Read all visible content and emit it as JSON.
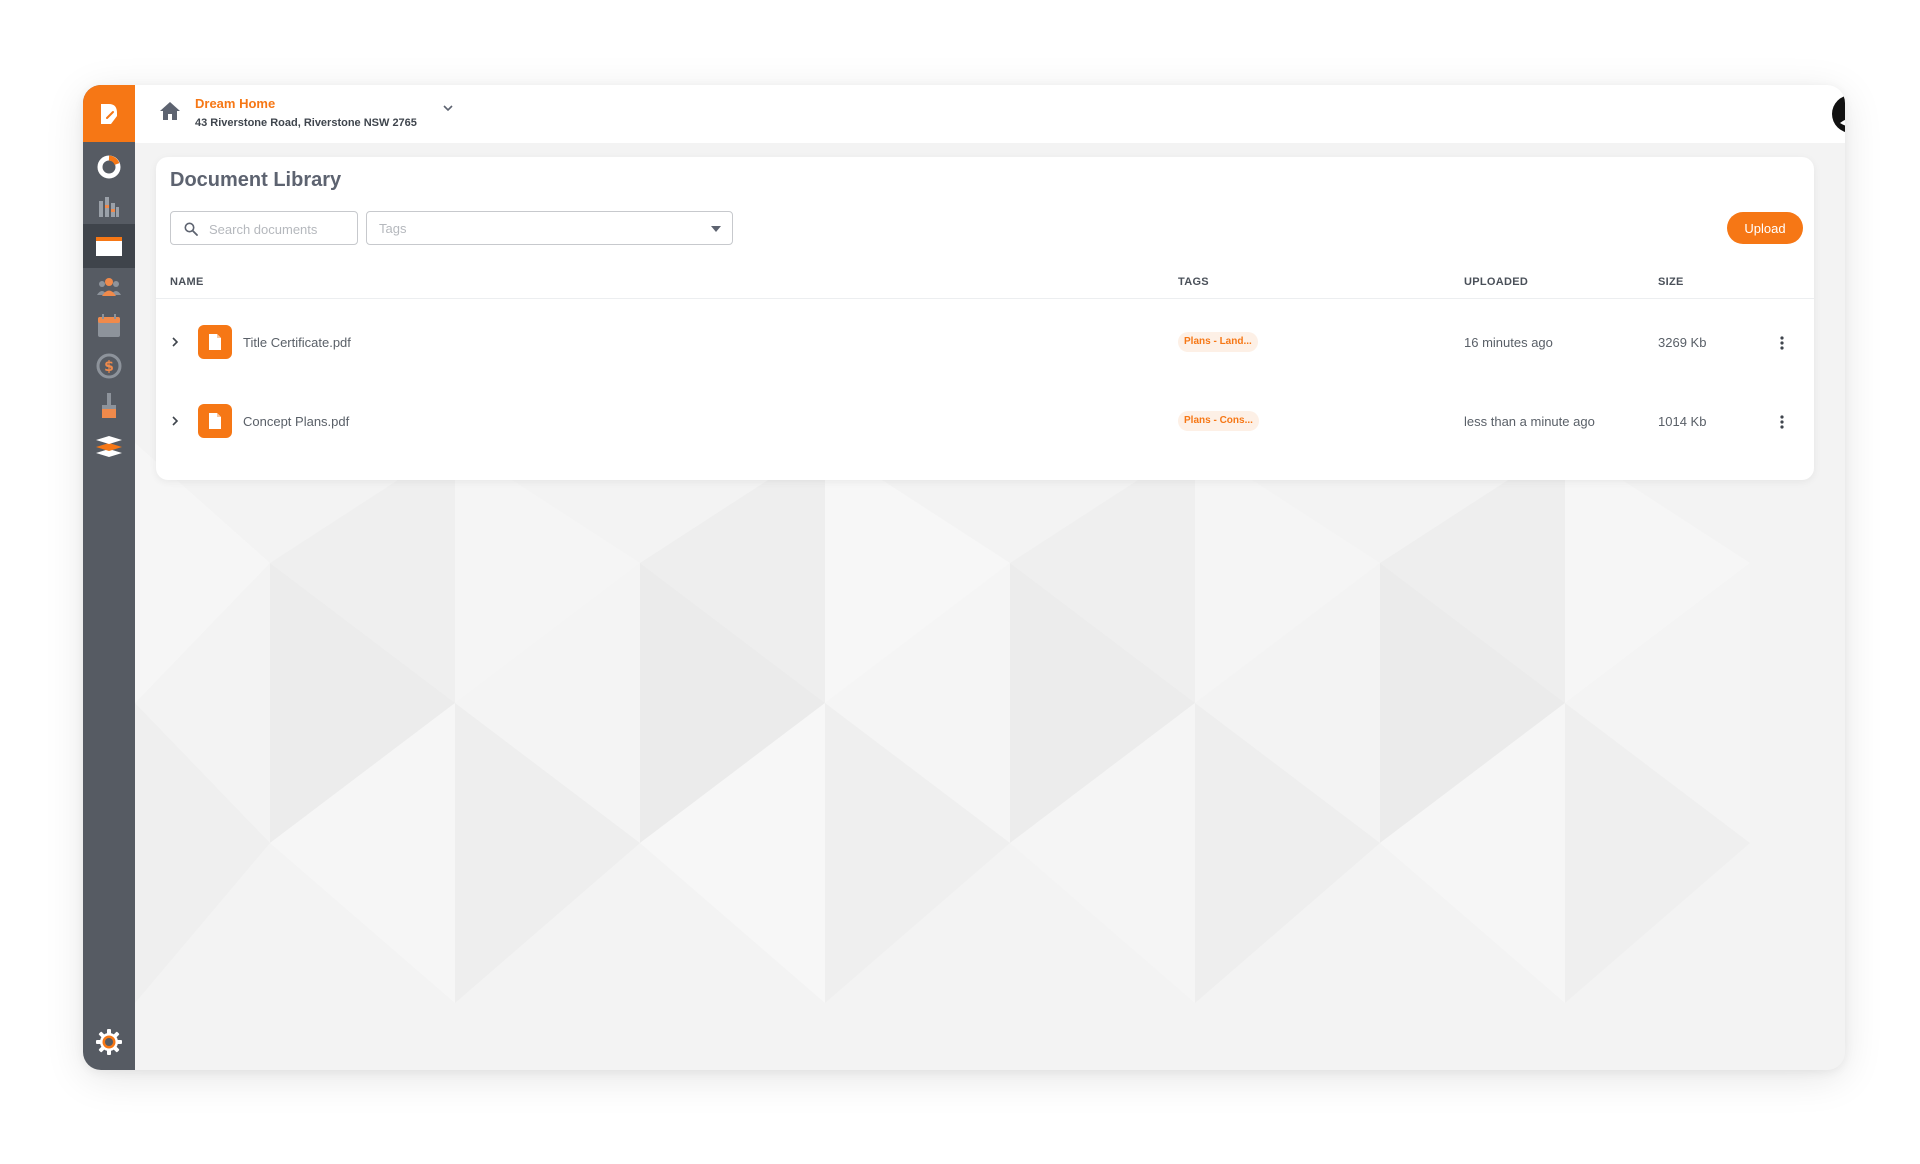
{
  "project": {
    "name": "Dream Home",
    "address": "43 Riverstone Road, Riverstone NSW 2765"
  },
  "sidebar": {
    "items": [
      {
        "icon": "progress-icon"
      },
      {
        "icon": "bar-chart-icon"
      },
      {
        "icon": "folder-icon",
        "active": true
      },
      {
        "icon": "team-icon"
      },
      {
        "icon": "calendar-icon"
      },
      {
        "icon": "dollar-icon"
      },
      {
        "icon": "paint-brush-icon"
      },
      {
        "icon": "layers-icon"
      }
    ],
    "settings_icon": "settings-gear-icon"
  },
  "page": {
    "title": "Document Library",
    "search_placeholder": "Search documents",
    "tags_placeholder": "Tags",
    "upload_label": "Upload"
  },
  "table": {
    "columns": [
      "NAME",
      "TAGS",
      "UPLOADED",
      "SIZE"
    ],
    "rows": [
      {
        "name": "Title Certificate.pdf",
        "tag": "Plans - Land...",
        "uploaded": "16 minutes ago",
        "size": "3269 Kb"
      },
      {
        "name": "Concept Plans.pdf",
        "tag": "Plans - Cons...",
        "uploaded": "less than a minute ago",
        "size": "1014 Kb"
      }
    ]
  },
  "colors": {
    "accent": "#f67715",
    "sidebar": "#565b63",
    "sidebar_active": "#3f444b",
    "title": "#5d6370"
  }
}
